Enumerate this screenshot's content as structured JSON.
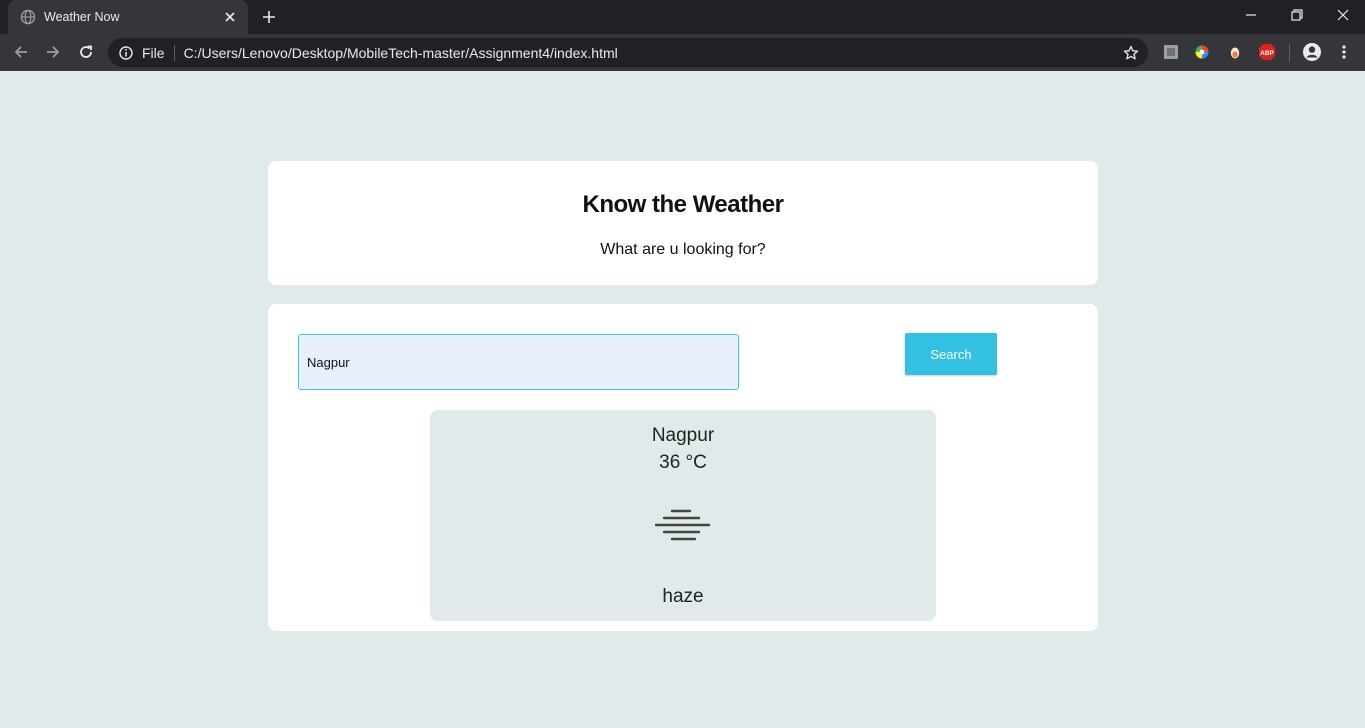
{
  "browser": {
    "tab_title": "Weather Now",
    "address_scheme_label": "File",
    "url": "C:/Users/Lenovo/Desktop/MobileTech-master/Assignment4/index.html"
  },
  "header": {
    "title": "Know the Weather",
    "subtitle": "What are u looking for?"
  },
  "search": {
    "input_value": "Nagpur",
    "button_label": "Search"
  },
  "weather": {
    "city": "Nagpur",
    "temperature": "36 °C",
    "description": "haze",
    "icon": "haze-icon"
  },
  "colors": {
    "page_background": "#e0eaea",
    "card_background": "#ffffff",
    "accent_button": "#33c1e3",
    "input_border": "#3ec6e0",
    "input_background": "#e8f0fe"
  }
}
